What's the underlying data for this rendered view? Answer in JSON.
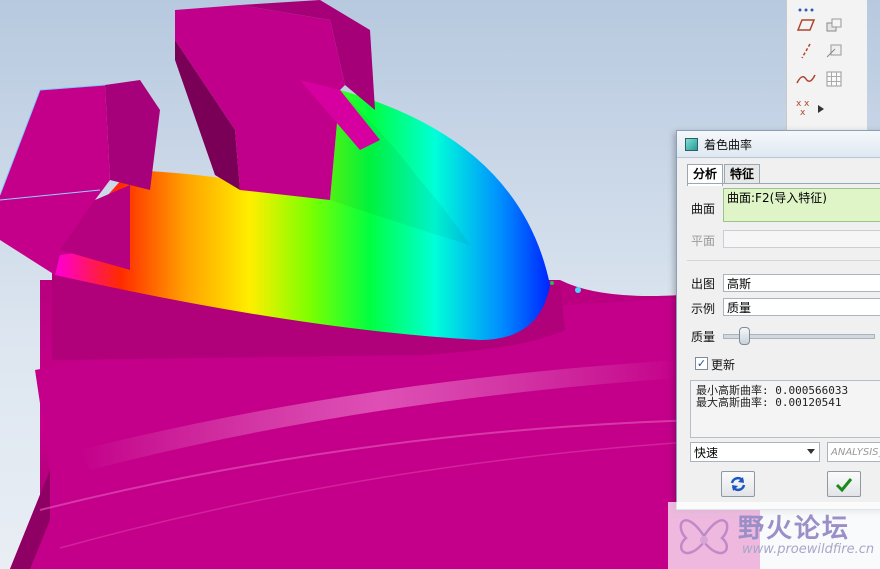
{
  "dialog": {
    "title": "着色曲率",
    "tabs": [
      "分析",
      "特征"
    ],
    "surface": {
      "label": "曲面",
      "value": "曲面:F2(导入特征)"
    },
    "plane": {
      "label": "平面",
      "value": ""
    },
    "output": {
      "label": "出图",
      "value": "高斯"
    },
    "display": {
      "label": "示例",
      "value": "质量"
    },
    "quality": {
      "label": "质量",
      "fraction": 0.13
    },
    "update": {
      "label": "更新",
      "checked": true
    },
    "results": {
      "min_label": "最小高斯曲率:",
      "min_value": "0.000566033",
      "max_label": "最大高斯曲率:",
      "max_value": "0.00120541"
    },
    "mode": {
      "value": "快速"
    },
    "analysis_name": {
      "value": "ANALYSIS_"
    },
    "buttons": {
      "repeat_icon": "repeat-icon",
      "ok_icon": "check-icon"
    }
  },
  "toolbar": {
    "icons": [
      "sketch-points-icon",
      "plane-icon",
      "axis-icon",
      "curve-icon",
      "coordinate-system-icon",
      "datum-shape-icon",
      "grid-icon"
    ]
  },
  "watermark": {
    "title": "野火论坛",
    "url": "www.proewildfire.cn"
  },
  "colors": {
    "part": "#c80089",
    "part_dark": "#8e0063",
    "part_light": "#d92ca6",
    "background_top": "#b7c9df"
  }
}
